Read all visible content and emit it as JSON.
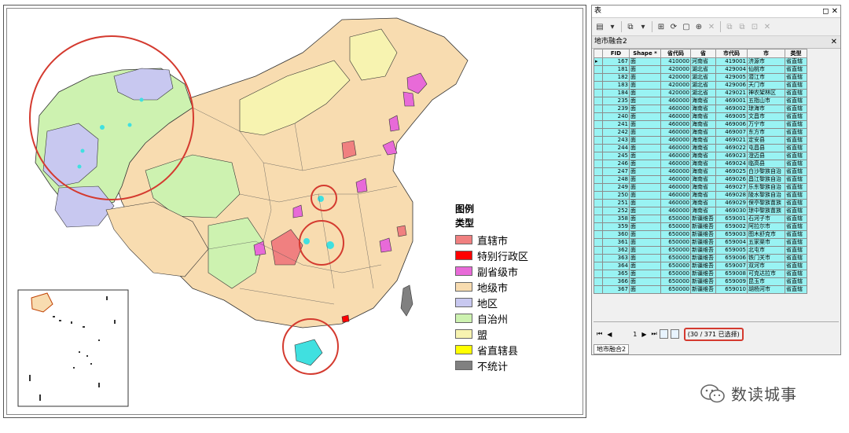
{
  "legend": {
    "title": "图例",
    "subtitle": "类型",
    "items": [
      {
        "label": "直辖市",
        "color": "#f08080"
      },
      {
        "label": "特别行政区",
        "color": "#ff0000"
      },
      {
        "label": "副省级市",
        "color": "#e86ad8"
      },
      {
        "label": "地级市",
        "color": "#f8dcb0"
      },
      {
        "label": "地区",
        "color": "#c8c8f0"
      },
      {
        "label": "自治州",
        "color": "#cdf2b0"
      },
      {
        "label": "盟",
        "color": "#f7f3b0"
      },
      {
        "label": "省直辖县",
        "color": "#ffff00"
      },
      {
        "label": "不统计",
        "color": "#808080"
      }
    ]
  },
  "table_window": {
    "title": "表",
    "tab_label": "地市融合2",
    "bottom_tab": "地市融合2",
    "columns": [
      "FID",
      "Shape *",
      "省代码",
      "省",
      "市代码",
      "市",
      "类型"
    ],
    "rows": [
      [
        "167",
        "面",
        "410000",
        "河南省",
        "419001",
        "济源市",
        "省直辖"
      ],
      [
        "181",
        "面",
        "420000",
        "湖北省",
        "429004",
        "仙桃市",
        "省直辖"
      ],
      [
        "182",
        "面",
        "420000",
        "湖北省",
        "429005",
        "潜江市",
        "省直辖"
      ],
      [
        "183",
        "面",
        "420000",
        "湖北省",
        "429006",
        "天门市",
        "省直辖"
      ],
      [
        "184",
        "面",
        "420000",
        "湖北省",
        "429021",
        "神农架林区",
        "省直辖"
      ],
      [
        "235",
        "面",
        "460000",
        "海南省",
        "469001",
        "五指山市",
        "省直辖"
      ],
      [
        "239",
        "面",
        "460000",
        "海南省",
        "469002",
        "琼海市",
        "省直辖"
      ],
      [
        "240",
        "面",
        "460000",
        "海南省",
        "469005",
        "文昌市",
        "省直辖"
      ],
      [
        "241",
        "面",
        "460000",
        "海南省",
        "469006",
        "万宁市",
        "省直辖"
      ],
      [
        "242",
        "面",
        "460000",
        "海南省",
        "469007",
        "东方市",
        "省直辖"
      ],
      [
        "243",
        "面",
        "460000",
        "海南省",
        "469021",
        "定安县",
        "省直辖"
      ],
      [
        "244",
        "面",
        "460000",
        "海南省",
        "469022",
        "屯昌县",
        "省直辖"
      ],
      [
        "245",
        "面",
        "460000",
        "海南省",
        "469023",
        "澄迈县",
        "省直辖"
      ],
      [
        "246",
        "面",
        "460000",
        "海南省",
        "469024",
        "临高县",
        "省直辖"
      ],
      [
        "247",
        "面",
        "460000",
        "海南省",
        "469025",
        "白沙黎族自治",
        "省直辖"
      ],
      [
        "248",
        "面",
        "460000",
        "海南省",
        "469026",
        "昌江黎族自治",
        "省直辖"
      ],
      [
        "249",
        "面",
        "460000",
        "海南省",
        "469027",
        "乐东黎族自治",
        "省直辖"
      ],
      [
        "250",
        "面",
        "460000",
        "海南省",
        "469028",
        "陵水黎族自治",
        "省直辖"
      ],
      [
        "251",
        "面",
        "460000",
        "海南省",
        "469029",
        "保亭黎族苗族",
        "省直辖"
      ],
      [
        "252",
        "面",
        "460000",
        "海南省",
        "469030",
        "琼中黎族苗族",
        "省直辖"
      ],
      [
        "358",
        "面",
        "650000",
        "新疆维吾",
        "659001",
        "石河子市",
        "省直辖"
      ],
      [
        "359",
        "面",
        "650000",
        "新疆维吾",
        "659002",
        "阿拉尔市",
        "省直辖"
      ],
      [
        "360",
        "面",
        "650000",
        "新疆维吾",
        "659003",
        "图木舒克市",
        "省直辖"
      ],
      [
        "361",
        "面",
        "650000",
        "新疆维吾",
        "659004",
        "五家渠市",
        "省直辖"
      ],
      [
        "362",
        "面",
        "650000",
        "新疆维吾",
        "659005",
        "北屯市",
        "省直辖"
      ],
      [
        "363",
        "面",
        "650000",
        "新疆维吾",
        "659006",
        "铁门关市",
        "省直辖"
      ],
      [
        "364",
        "面",
        "650000",
        "新疆维吾",
        "659007",
        "双河市",
        "省直辖"
      ],
      [
        "365",
        "面",
        "650000",
        "新疆维吾",
        "659008",
        "可克达拉市",
        "省直辖"
      ],
      [
        "366",
        "面",
        "650000",
        "新疆维吾",
        "659009",
        "昆玉市",
        "省直辖"
      ],
      [
        "367",
        "面",
        "650000",
        "新疆维吾",
        "659010",
        "胡杨河市",
        "省直辖"
      ]
    ],
    "nav": {
      "current_record": "1",
      "selection_text": "(30 / 371 已选择)"
    }
  },
  "watermark": {
    "text": "数读城事"
  }
}
